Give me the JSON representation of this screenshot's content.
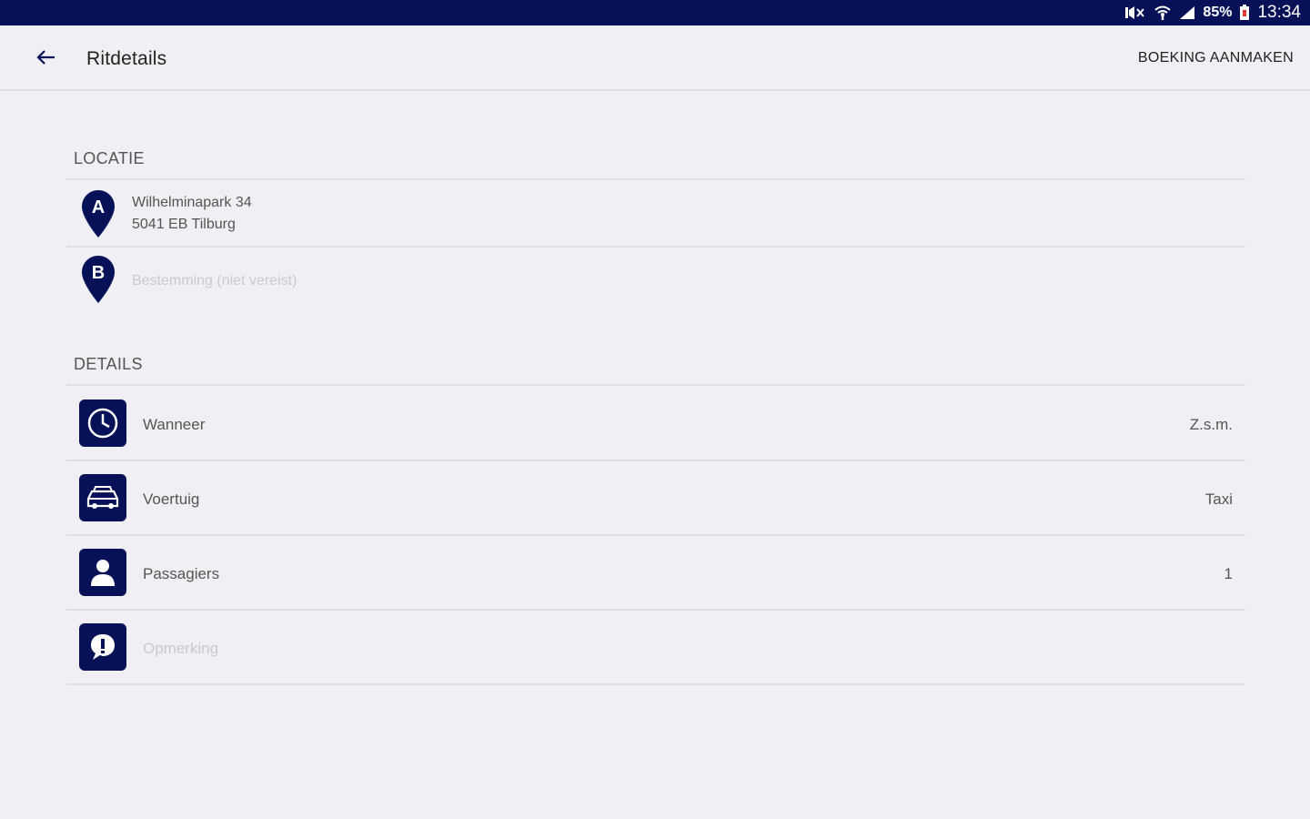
{
  "status_bar": {
    "battery": "85%",
    "time": "13:34",
    "icons": [
      "mute-icon",
      "wifi-icon",
      "signal-icon",
      "battery-icon"
    ]
  },
  "app_bar": {
    "title": "Ritdetails",
    "back_icon": "arrow-left-icon",
    "action": "BOEKING AANMAKEN"
  },
  "location": {
    "header": "LOCATIE",
    "pickup": {
      "marker": "A",
      "line1": "Wilhelminapark 34",
      "line2": "5041 EB Tilburg"
    },
    "destination": {
      "marker": "B",
      "placeholder": "Bestemming (niet vereist)"
    }
  },
  "details": {
    "header": "DETAILS",
    "rows": [
      {
        "icon": "clock-icon",
        "label": "Wanneer",
        "value": "Z.s.m."
      },
      {
        "icon": "car-icon",
        "label": "Voertuig",
        "value": "Taxi"
      },
      {
        "icon": "person-icon",
        "label": "Passagiers",
        "value": "1"
      },
      {
        "icon": "comment-icon",
        "label": "Opmerking",
        "value": ""
      }
    ]
  },
  "colors": {
    "brand": "#061157",
    "background": "#efeff4",
    "placeholder_text": "#c9c9d2"
  }
}
